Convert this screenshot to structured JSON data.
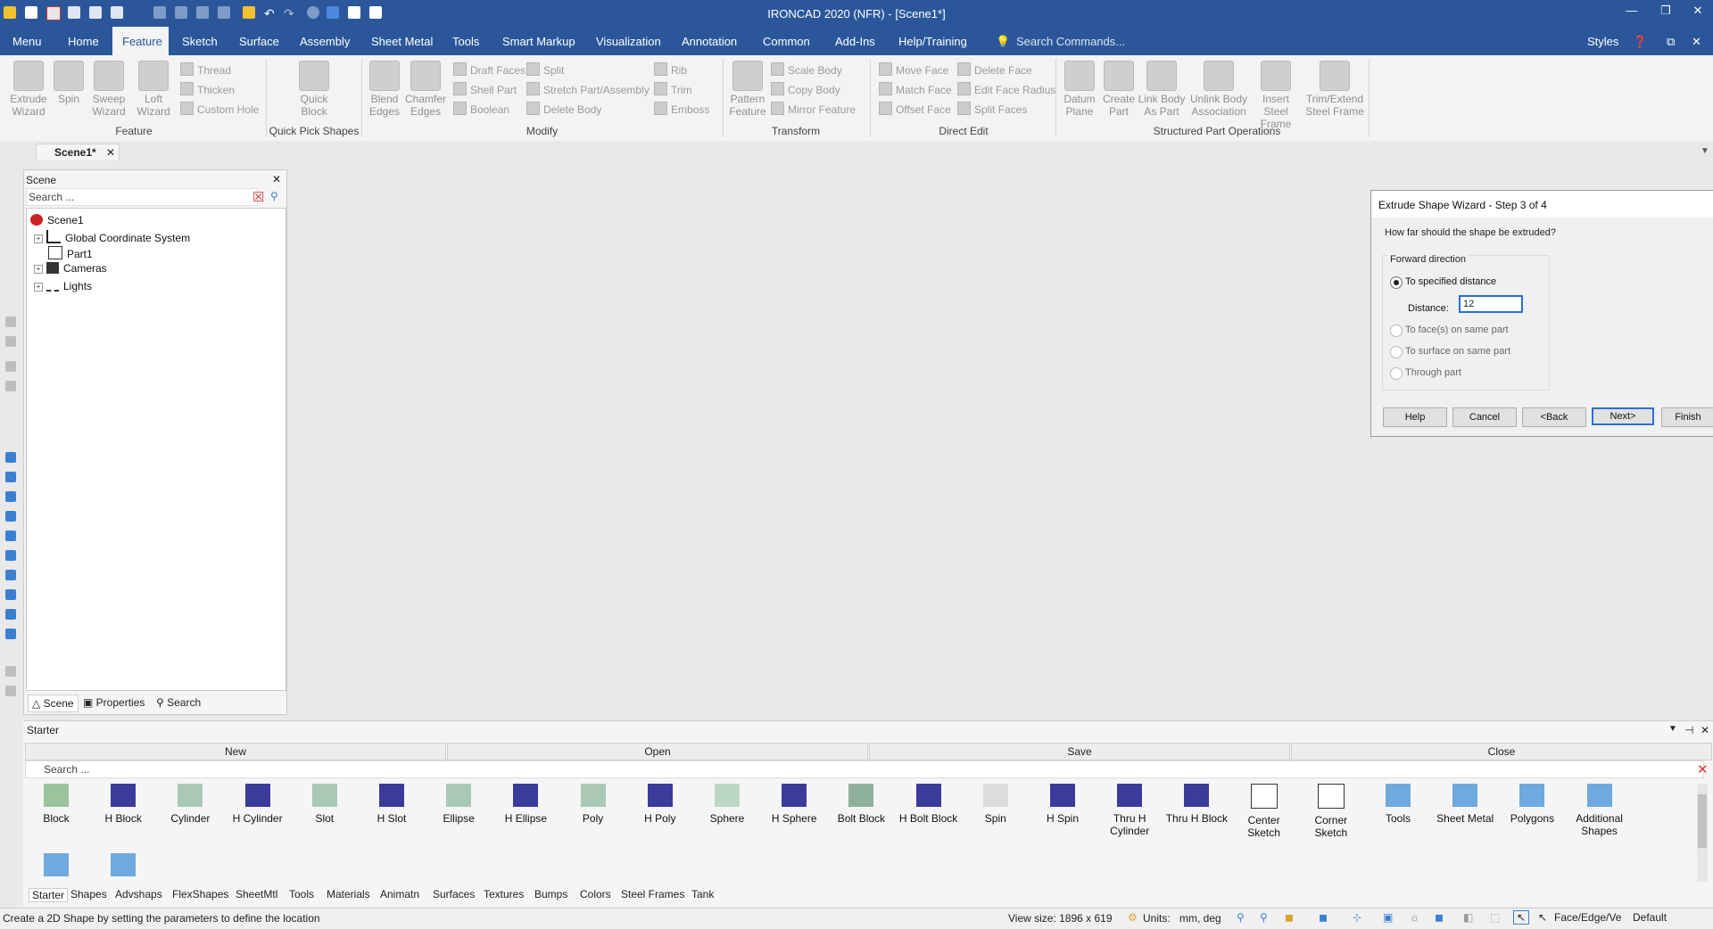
{
  "app": {
    "title": "IRONCAD 2020 (NFR) - [Scene1*]",
    "styles_label": "Styles"
  },
  "menu_tabs": [
    "Menu",
    "Home",
    "Feature",
    "Sketch",
    "Surface",
    "Assembly",
    "Sheet Metal",
    "Tools",
    "Smart Markup",
    "Visualization",
    "Annotation",
    "Common",
    "Add-Ins",
    "Help/Training"
  ],
  "search_commands_placeholder": "Search Commands...",
  "ribbon": {
    "feature_group": {
      "label": "Feature",
      "big": [
        "Extrude Wizard",
        "Spin",
        "Sweep Wizard",
        "Loft Wizard"
      ],
      "small": [
        "Thread",
        "Thicken",
        "Custom Hole"
      ]
    },
    "quick_pick": {
      "label": "Quick Pick Shapes",
      "big": [
        "Quick Block"
      ]
    },
    "modify": {
      "label": "Modify",
      "big": [
        "Blend Edges",
        "Chamfer Edges"
      ],
      "small": [
        "Draft Faces",
        "Shell Part",
        "Boolean",
        "Split",
        "Stretch Part/Assembly",
        "Delete Body",
        "Rib",
        "Trim",
        "Emboss"
      ]
    },
    "transform": {
      "label": "Transform",
      "big": [
        "Pattern Feature"
      ],
      "small": [
        "Scale Body",
        "Copy Body",
        "Mirror Feature"
      ]
    },
    "direct_edit": {
      "label": "Direct Edit",
      "small": [
        "Move Face",
        "Match Face",
        "Offset Face",
        "Delete Face",
        "Edit Face Radius",
        "Split Faces"
      ]
    },
    "structured": {
      "label": "Structured Part Operations",
      "big": [
        "Datum Plane",
        "Create Part",
        "Link Body As Part",
        "Unlink Body Association",
        "Insert Steel Frame",
        "Trim/Extend Steel Frame"
      ]
    }
  },
  "doc_tab": "Scene1*",
  "scene_panel": {
    "title": "Scene",
    "search_placeholder": "Search ...",
    "tree": [
      "Scene1",
      "Global Coordinate System",
      "Part1",
      "Cameras",
      "Lights"
    ],
    "tabs": [
      "Scene",
      "Properties",
      "Search"
    ]
  },
  "wizard": {
    "title": "Extrude Shape Wizard - Step 3 of 4",
    "question": "How far should the shape be extruded?",
    "group_label": "Forward direction",
    "options": [
      "To specified distance",
      "To face(s) on same part",
      "To surface on same part",
      "Through part"
    ],
    "selected_option": "To specified distance",
    "distance_label": "Distance:",
    "distance_value": "12",
    "buttons": [
      "Help",
      "Cancel",
      "<Back",
      "Next>",
      "Finish"
    ]
  },
  "catalog": {
    "title": "Starter",
    "headers": [
      "New",
      "Open",
      "Save",
      "Close"
    ],
    "search_placeholder": "Search ...",
    "shapes": [
      "Block",
      "H Block",
      "Cylinder",
      "H Cylinder",
      "Slot",
      "H Slot",
      "Ellipse",
      "H Ellipse",
      "Poly",
      "H Poly",
      "Sphere",
      "H Sphere",
      "Bolt Block",
      "H Bolt Block",
      "Spin",
      "H Spin",
      "Thru H Cylinder",
      "Thru H Block",
      "Center Sketch",
      "Corner Sketch",
      "Tools",
      "Sheet Metal",
      "Polygons",
      "Additional Shapes"
    ],
    "bottom_tabs": [
      "Starter",
      "Shapes",
      "Advshaps",
      "FlexShapes",
      "SheetMtl",
      "Tools",
      "Materials",
      "Animatn",
      "Surfaces",
      "Textures",
      "Bumps",
      "Colors",
      "Steel Frames",
      "Tank"
    ]
  },
  "status": {
    "message": "Create a 2D Shape by setting the parameters to define the location",
    "view_size": "View size: 1896 x  619",
    "units_label": "Units:",
    "units_value": "mm, deg",
    "selection_mode": "Face/Edge/Ve",
    "style": "Default"
  },
  "colors": {
    "accent": "#2b579a",
    "ribbon_bg": "#f3f3f3",
    "workspace": "#e9e9e9"
  }
}
